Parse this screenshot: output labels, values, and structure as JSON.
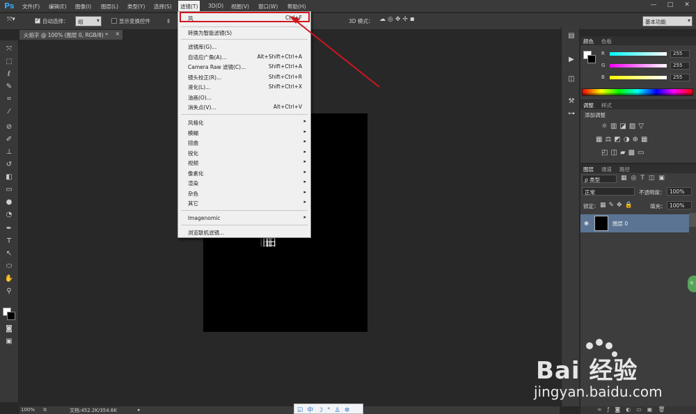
{
  "app": {
    "logo": "Ps"
  },
  "menubar": {
    "items": [
      "文件(F)",
      "编辑(E)",
      "图像(I)",
      "图层(L)",
      "类型(Y)",
      "选择(S)",
      "滤镜(T)",
      "3D(D)",
      "视图(V)",
      "窗口(W)",
      "帮助(H)"
    ],
    "active_item": "滤镜(T)"
  },
  "window_controls": [
    "—",
    "□",
    "✕"
  ],
  "options_bar": {
    "auto_select_label": "自动选择：",
    "auto_select_checked": true,
    "auto_select_value": "组",
    "show_transform_label": "显示变换控件",
    "show_transform_checked": false,
    "mode_3d_label": "3D 模式：",
    "workspace": "基本功能"
  },
  "document_tab": {
    "title": "火焰字 @ 100% (图层 0, RGB/8) *",
    "close": "×"
  },
  "filter_menu": {
    "top_item": {
      "label": "风",
      "shortcut": "Ctrl+F"
    },
    "smart_filter": "转换为智能滤镜(S)",
    "group1": [
      {
        "label": "滤镜库(G)...",
        "shortcut": ""
      },
      {
        "label": "自适应广角(A)...",
        "shortcut": "Alt+Shift+Ctrl+A"
      },
      {
        "label": "Camera Raw 滤镜(C)...",
        "shortcut": "Shift+Ctrl+A"
      },
      {
        "label": "镜头校正(R)...",
        "shortcut": "Shift+Ctrl+R"
      },
      {
        "label": "液化(L)...",
        "shortcut": "Shift+Ctrl+X"
      },
      {
        "label": "油画(O)...",
        "shortcut": ""
      },
      {
        "label": "消失点(V)...",
        "shortcut": "Alt+Ctrl+V"
      }
    ],
    "submenus": [
      "风格化",
      "模糊",
      "扭曲",
      "锐化",
      "视频",
      "像素化",
      "渲染",
      "杂色",
      "其它"
    ],
    "plugin": "Imagenomic",
    "browse": "浏览联机滤镜..."
  },
  "canvas": {
    "text": "旧"
  },
  "color_panel": {
    "tabs": [
      "颜色",
      "色板"
    ],
    "channels": [
      {
        "name": "R",
        "value": "255",
        "color": "#46e0e8"
      },
      {
        "name": "G",
        "value": "255",
        "color": "#d84ad8"
      },
      {
        "name": "B",
        "value": "255",
        "color": "#e8e040"
      }
    ]
  },
  "adjustments_panel": {
    "tabs": [
      "调整",
      "样式"
    ],
    "heading": "添加调整"
  },
  "layers_panel": {
    "tabs": [
      "图层",
      "通道",
      "路径"
    ],
    "filter_kind": "ρ 类型",
    "blend_mode": "正常",
    "opacity_label": "不透明度：",
    "opacity": "100%",
    "lock_label": "锁定：",
    "fill_label": "填充：",
    "fill": "100%",
    "layers": [
      {
        "name": "图层 0",
        "visible": true
      }
    ]
  },
  "status_bar": {
    "zoom": "100%",
    "doc_info": "文档:452.2K/354.6K"
  },
  "ime_toolbar": {
    "label": "中"
  },
  "watermark": {
    "logo": "Bai  经验",
    "url": "jingyan.baidu.com"
  }
}
